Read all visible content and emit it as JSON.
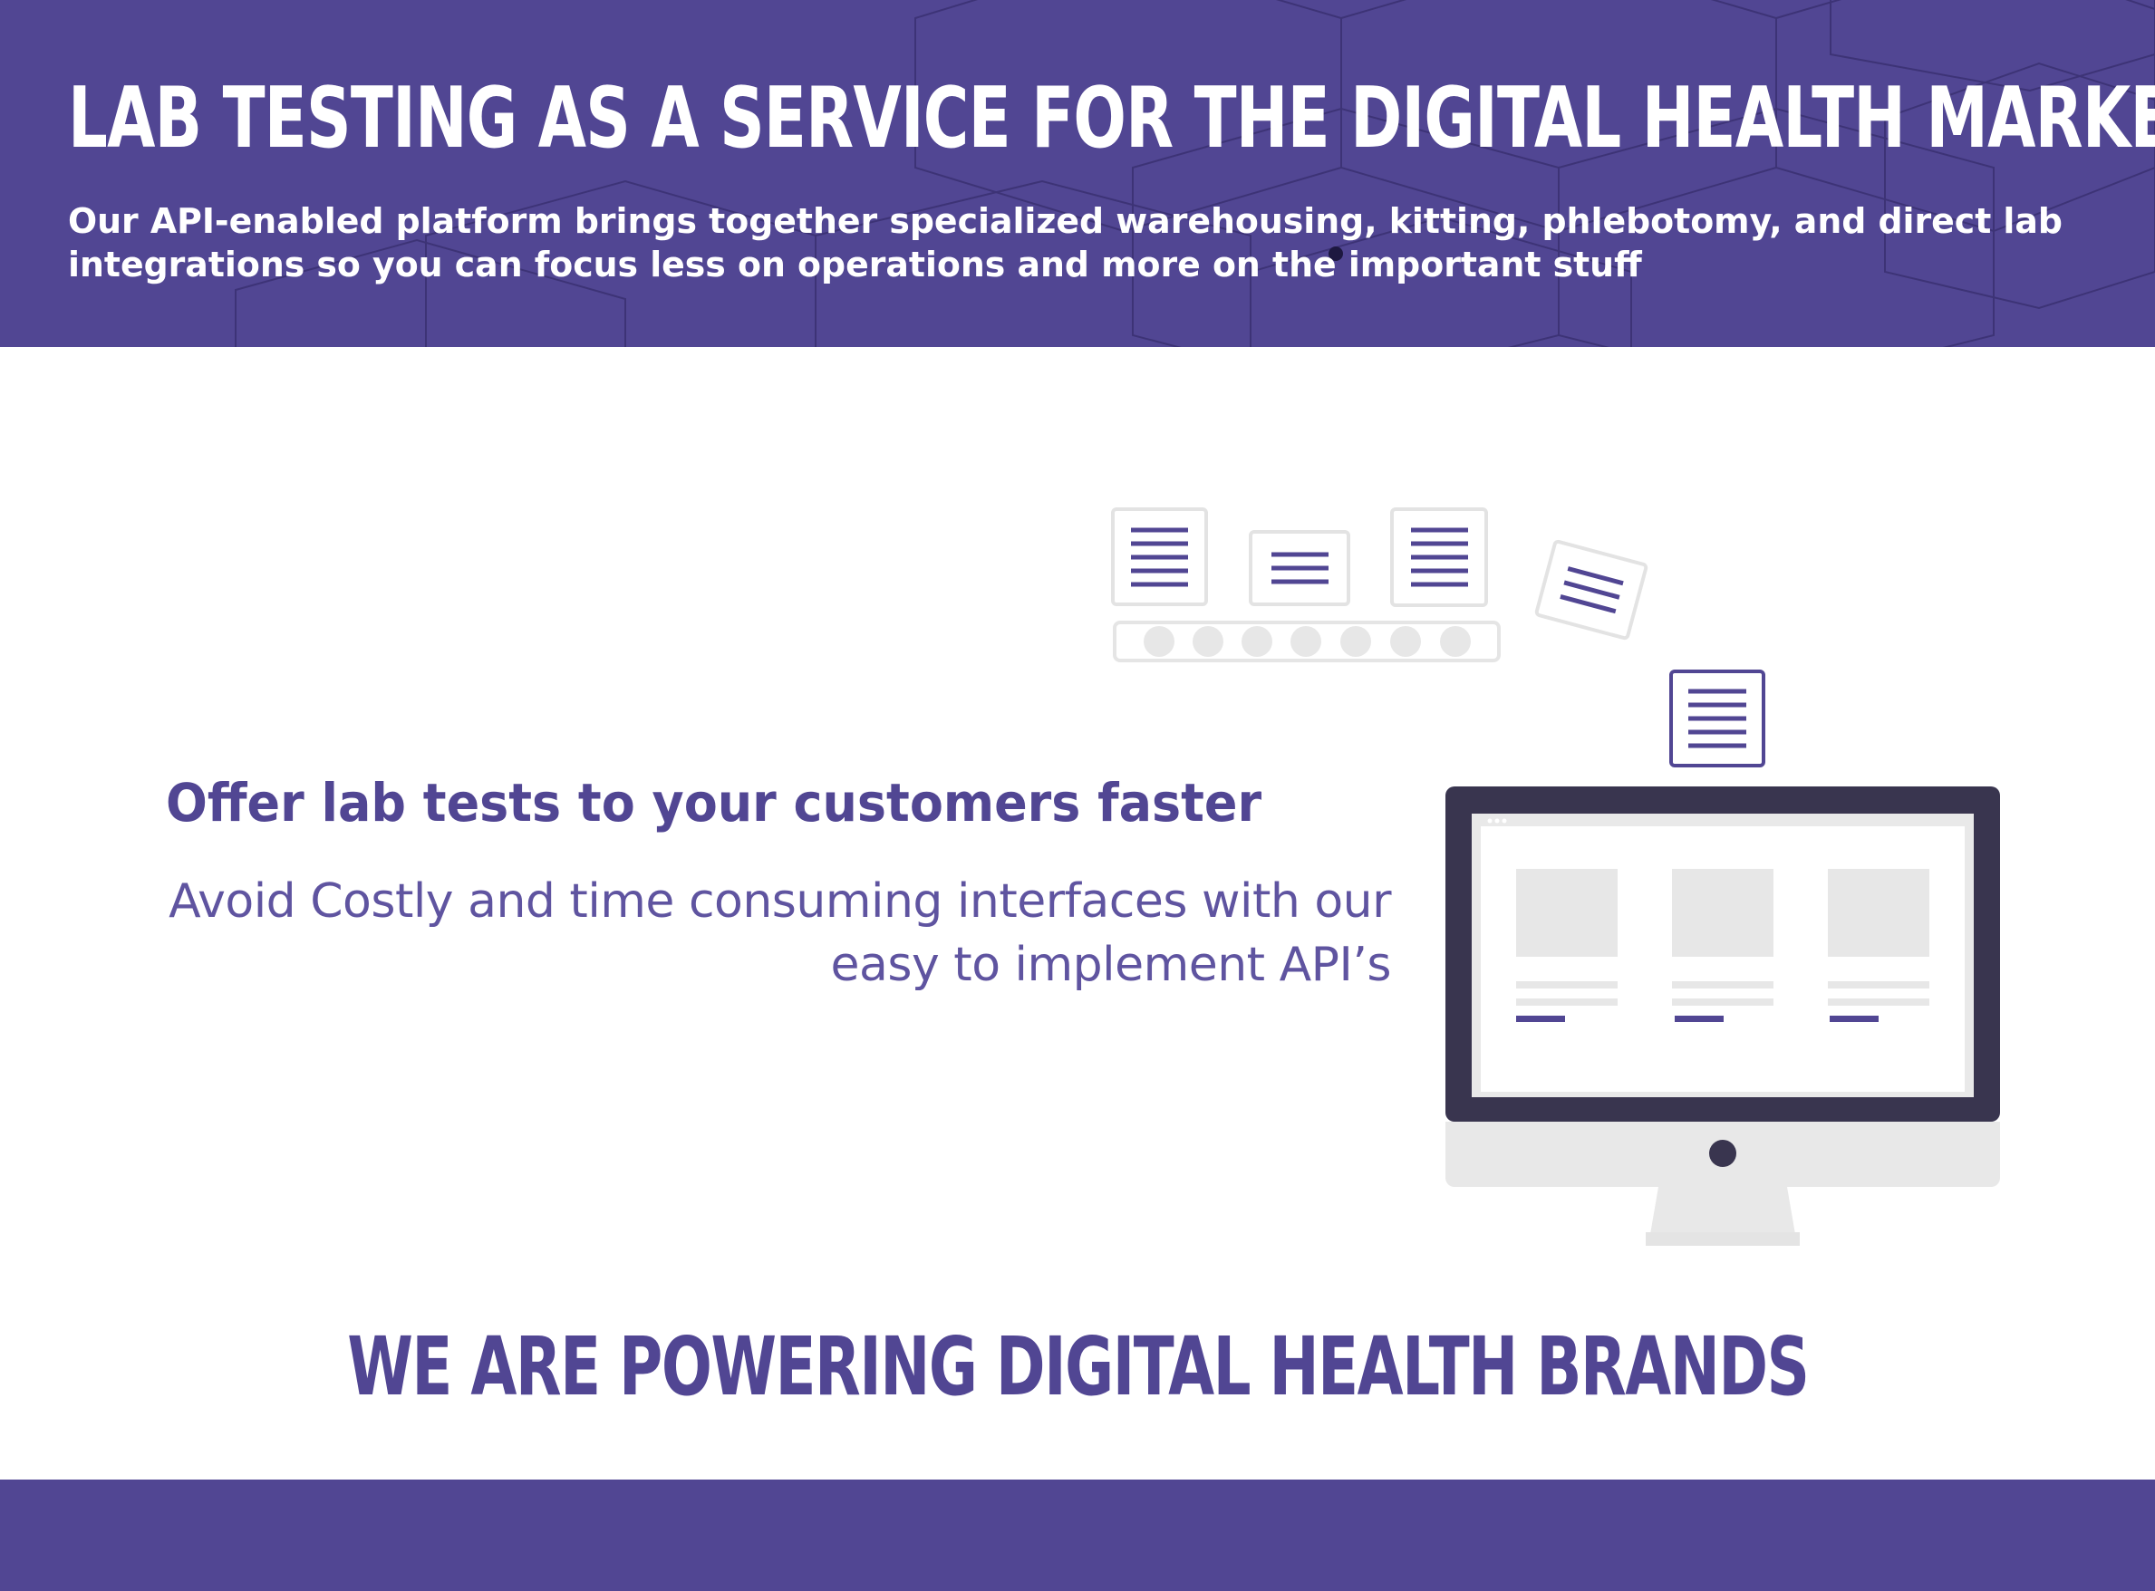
{
  "hero": {
    "title": "LAB TESTING AS A SERVICE FOR THE DIGITAL HEALTH MARKET",
    "subtitle": "Our API-enabled platform brings together specialized warehousing, kitting, phlebotomy, and direct lab integrations so you can focus less on operations and more on the important stuff"
  },
  "feature": {
    "heading": "Offer lab tests to your customers faster",
    "text": "Avoid Costly and time consuming interfaces with our easy to implement API’s",
    "illustration_icons": [
      "document-icon",
      "conveyor-icon",
      "monitor-icon"
    ]
  },
  "brands": {
    "heading": "WE ARE POWERING DIGITAL HEALTH BRANDS"
  },
  "colors": {
    "brand_purple": "#514693",
    "heading_purple": "#514693",
    "text_purple": "#5f54a0",
    "monitor_dark": "#39354f",
    "light_gray": "#e8e8e8"
  }
}
